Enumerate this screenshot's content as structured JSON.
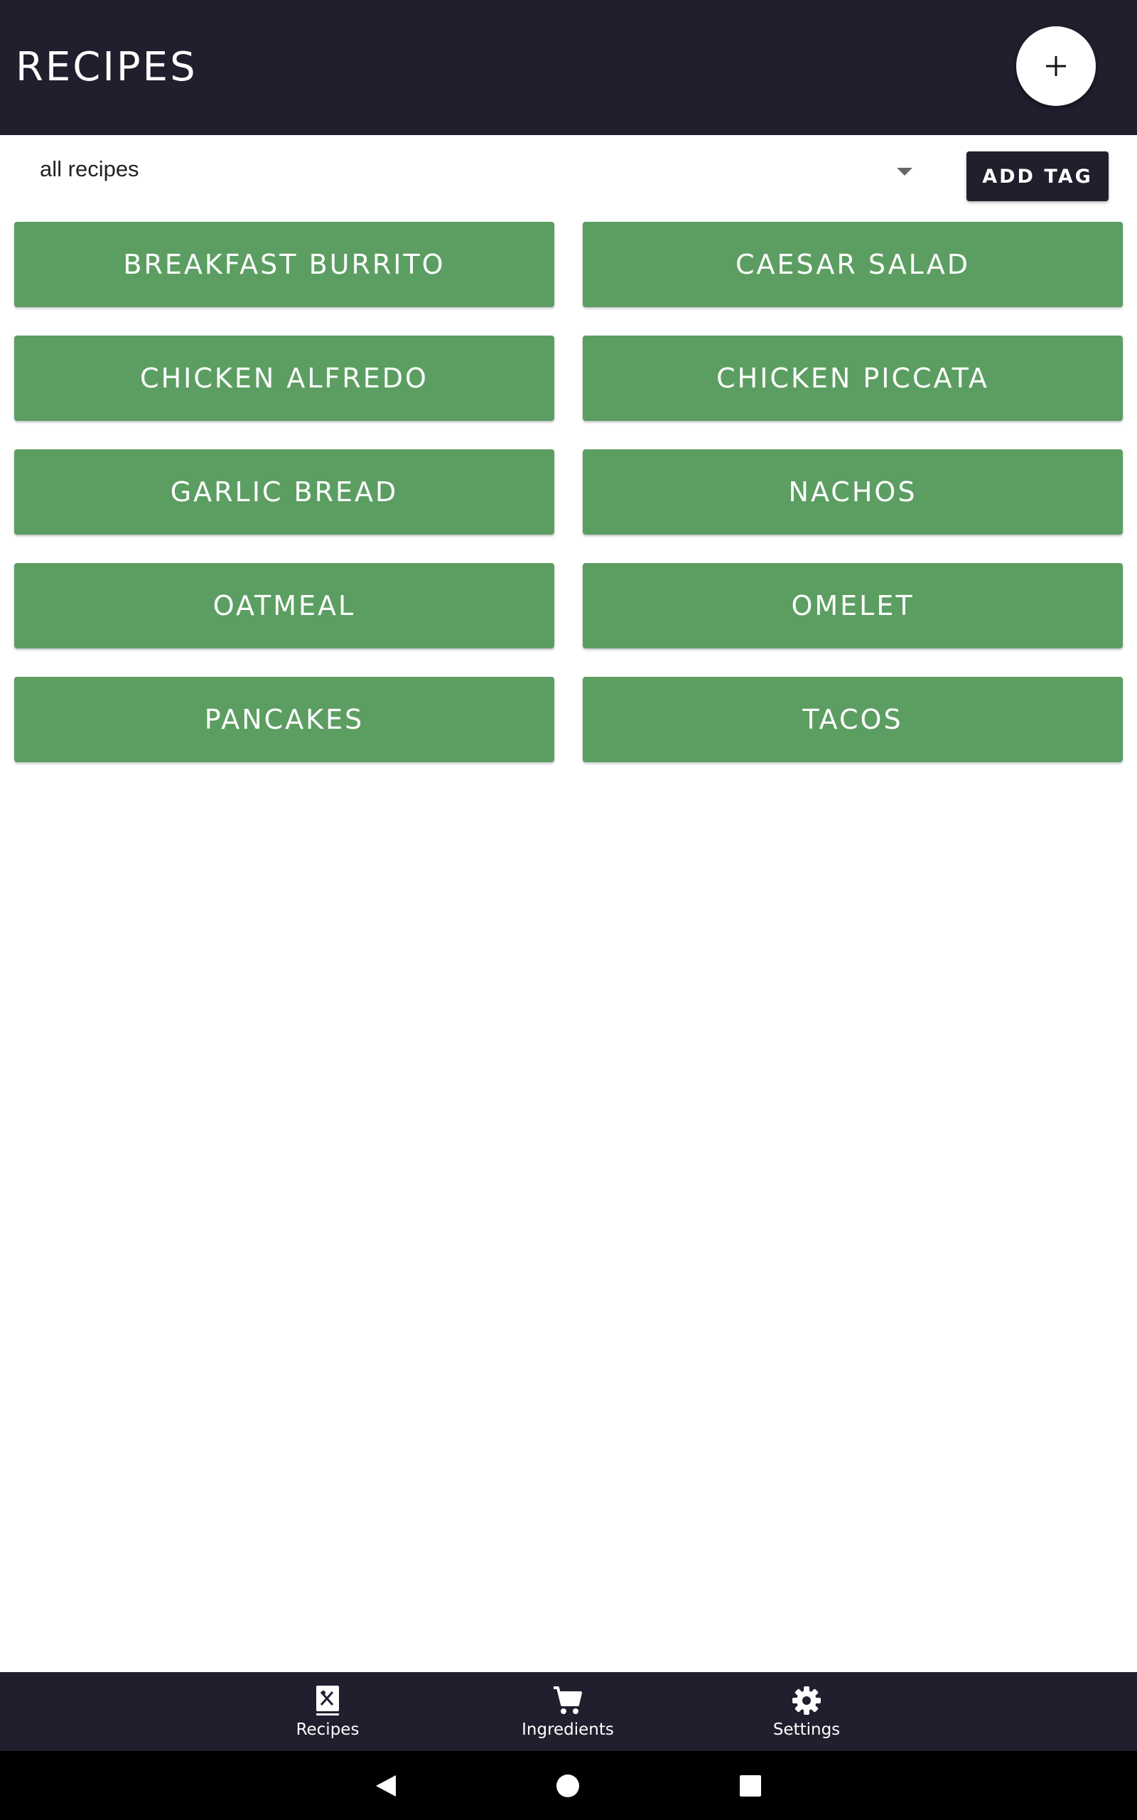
{
  "header": {
    "title": "RECIPES",
    "fab_icon": "plus-icon"
  },
  "filter": {
    "selected": "all recipes",
    "add_tag_label": "ADD TAG"
  },
  "recipes": [
    "BREAKFAST BURRITO",
    "CAESAR SALAD",
    "CHICKEN ALFREDO",
    "CHICKEN PICCATA",
    "GARLIC BREAD",
    "NACHOS",
    "OATMEAL",
    "OMELET",
    "PANCAKES",
    "TACOS"
  ],
  "bottom_nav": {
    "items": [
      {
        "label": "Recipes",
        "icon": "recipe-book-icon"
      },
      {
        "label": "Ingredients",
        "icon": "cart-icon"
      },
      {
        "label": "Settings",
        "icon": "gear-icon"
      }
    ]
  },
  "colors": {
    "dark": "#1f1f2e",
    "recipe_button": "#5c9e62"
  }
}
